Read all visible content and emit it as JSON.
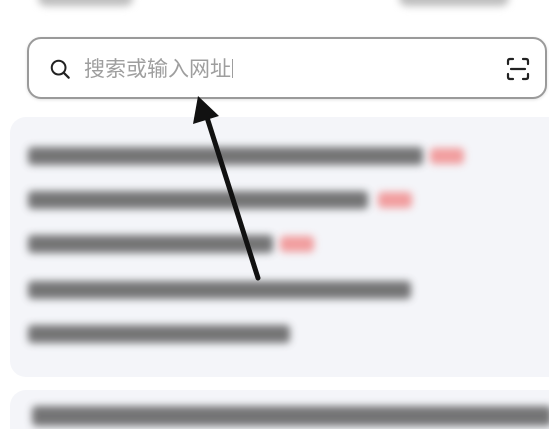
{
  "search": {
    "placeholder": "搜索或输入网址"
  },
  "icons": {
    "search": "search-icon",
    "scan": "scan-icon"
  },
  "colors": {
    "annotation_arrow": "#111111",
    "hot_tag": "#f08080"
  }
}
